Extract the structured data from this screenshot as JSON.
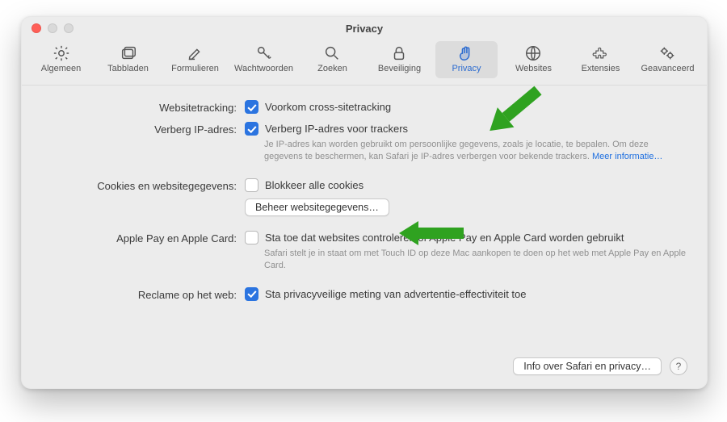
{
  "window": {
    "title": "Privacy"
  },
  "toolbar": {
    "tabs": [
      {
        "id": "general",
        "label": "Algemeen",
        "icon": "gear-icon"
      },
      {
        "id": "tabs",
        "label": "Tabbladen",
        "icon": "tabs-icon"
      },
      {
        "id": "autofill",
        "label": "Formulieren",
        "icon": "pen-icon"
      },
      {
        "id": "passwords",
        "label": "Wachtwoorden",
        "icon": "key-icon"
      },
      {
        "id": "search",
        "label": "Zoeken",
        "icon": "magnify-icon"
      },
      {
        "id": "security",
        "label": "Beveiliging",
        "icon": "lock-icon"
      },
      {
        "id": "privacy",
        "label": "Privacy",
        "icon": "hand-icon",
        "selected": true
      },
      {
        "id": "websites",
        "label": "Websites",
        "icon": "globe-icon"
      },
      {
        "id": "extensions",
        "label": "Extensies",
        "icon": "puzzle-icon"
      },
      {
        "id": "advanced",
        "label": "Geavanceerd",
        "icon": "gears-icon"
      }
    ]
  },
  "settings": {
    "tracking": {
      "label": "Websitetracking:",
      "checkbox_label": "Voorkom cross-sitetracking",
      "checked": true
    },
    "hide_ip": {
      "label": "Verberg IP-adres:",
      "checkbox_label": "Verberg IP-adres voor trackers",
      "checked": true,
      "help": "Je IP-adres kan worden gebruikt om persoonlijke gegevens, zoals je locatie, te bepalen. Om deze gegevens te beschermen, kan Safari je IP-adres verbergen voor bekende trackers. ",
      "help_link": "Meer informatie…"
    },
    "cookies": {
      "label": "Cookies en websitegegevens:",
      "checkbox_label": "Blokkeer alle cookies",
      "checked": false,
      "manage_button": "Beheer websitegegevens…"
    },
    "apple_pay": {
      "label": "Apple Pay en Apple Card:",
      "checkbox_label": "Sta toe dat websites controleren of Apple Pay en Apple Card worden gebruikt",
      "checked": false,
      "help": "Safari stelt je in staat om met Touch ID op deze Mac aankopen te doen op het web met Apple Pay en Apple Card."
    },
    "ads": {
      "label": "Reclame op het web:",
      "checkbox_label": "Sta privacyveilige meting van advertentie-effectiviteit toe",
      "checked": true
    }
  },
  "footer": {
    "info_button": "Info over Safari en privacy…",
    "help_label": "?"
  },
  "annotation_color": "#2fa220"
}
